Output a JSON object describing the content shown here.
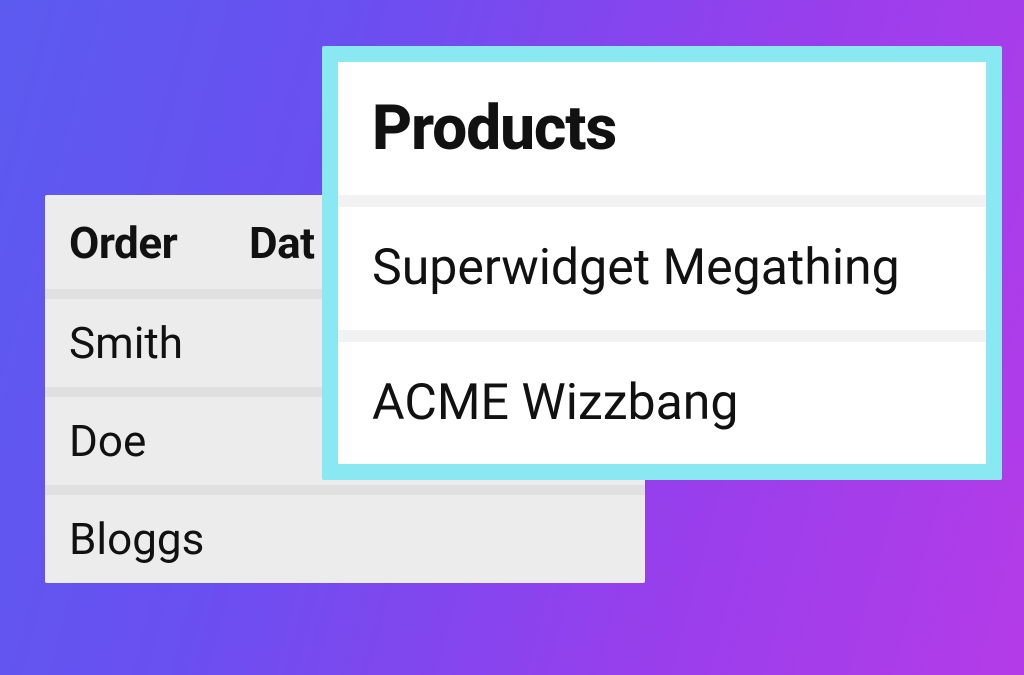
{
  "orders": {
    "columns": {
      "order": "Order",
      "date": "Dat"
    },
    "rows": [
      {
        "name": "Smith"
      },
      {
        "name": "Doe"
      },
      {
        "name": "Bloggs"
      }
    ]
  },
  "products": {
    "title": "Products",
    "items": [
      {
        "name": "Superwidget Megathing"
      },
      {
        "name": "ACME Wizzbang"
      }
    ]
  }
}
